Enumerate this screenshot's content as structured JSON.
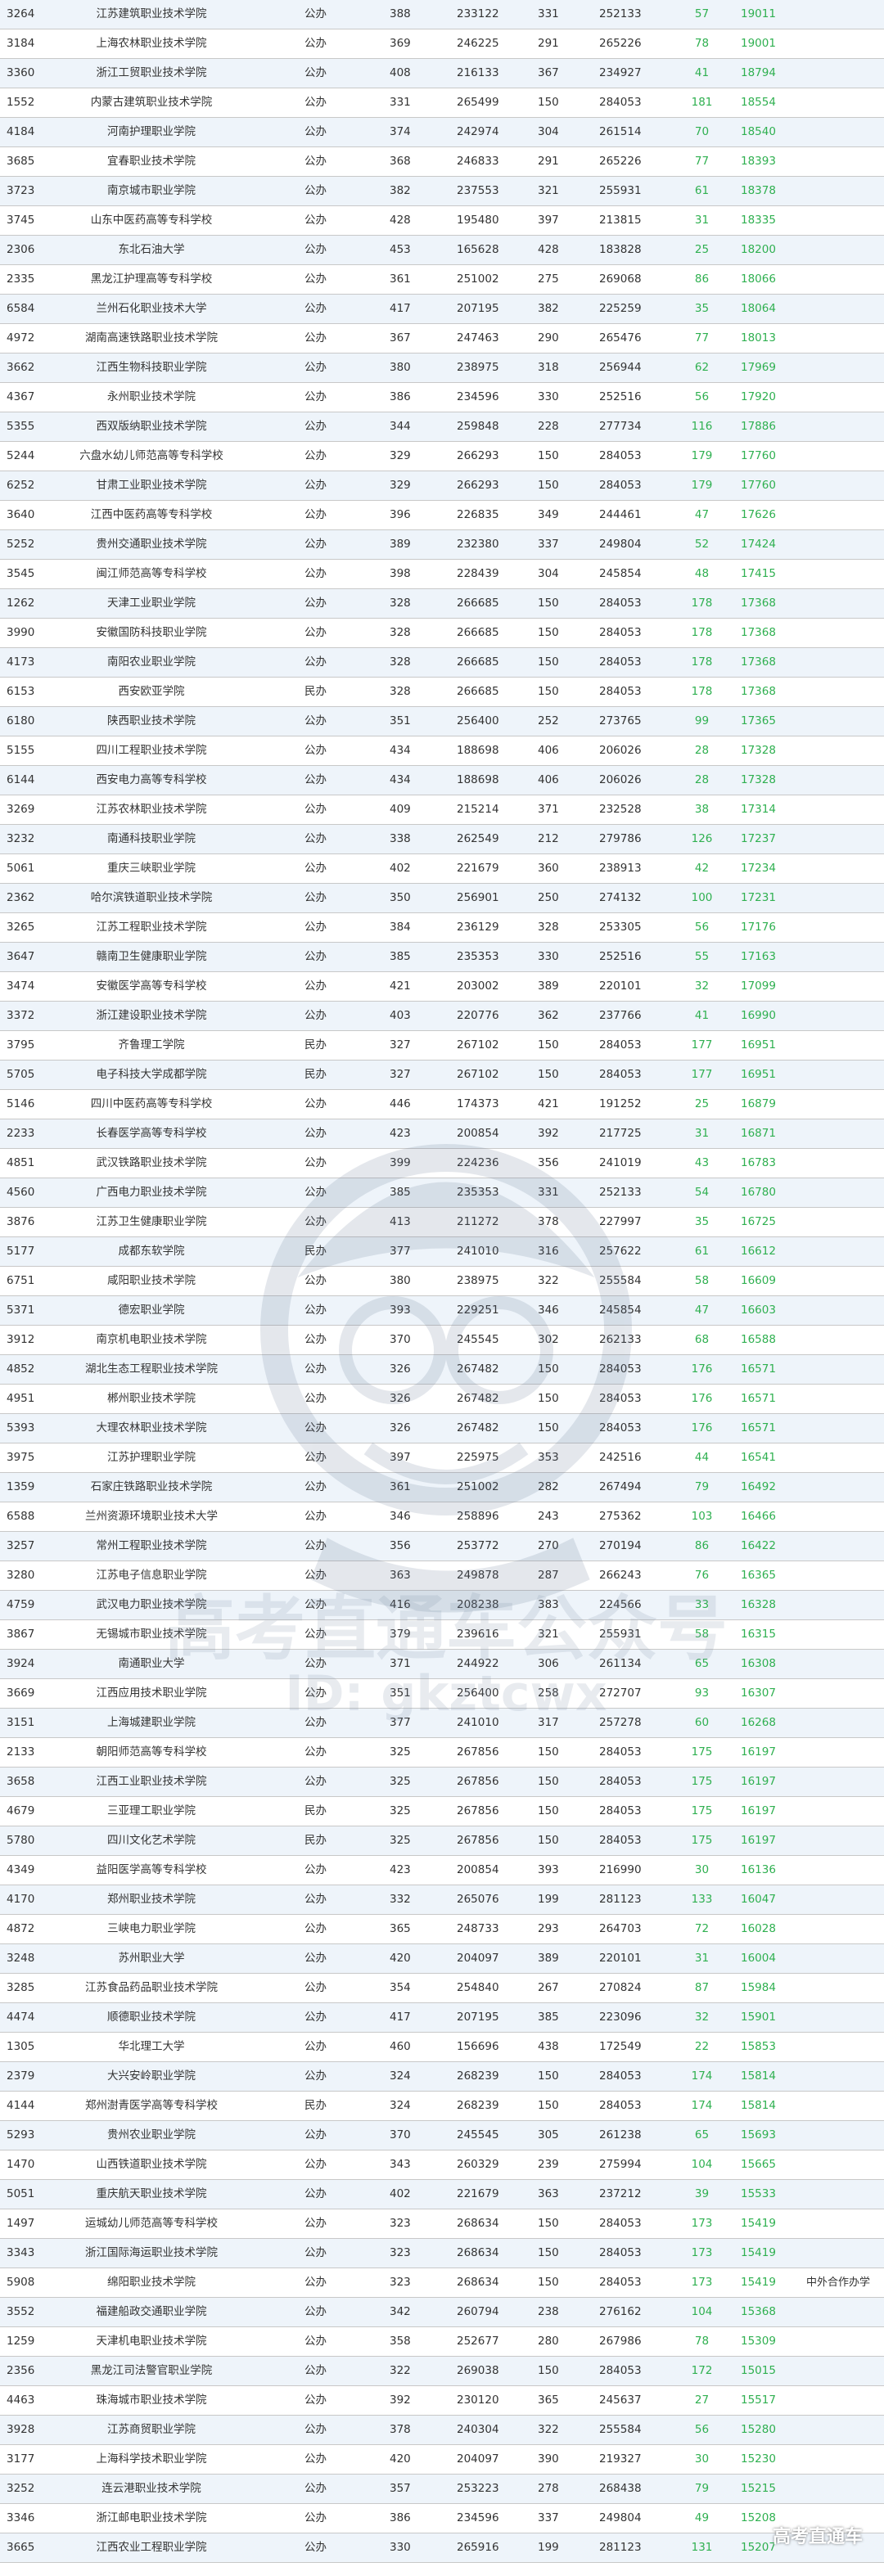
{
  "colors": {
    "accent_green": "#2fb050",
    "row_alt": "#eef4fa",
    "border": "#c8c8c8"
  },
  "watermark": {
    "line1": "高考直通车公众号",
    "line2": "ID: gkztcwx",
    "brand": "高考直通车"
  },
  "rows": [
    [
      "3264",
      "江苏建筑职业技术学院",
      "公办",
      "388",
      "233122",
      "331",
      "252133",
      "57",
      "19011",
      ""
    ],
    [
      "3184",
      "上海农林职业技术学院",
      "公办",
      "369",
      "246225",
      "291",
      "265226",
      "78",
      "19001",
      ""
    ],
    [
      "3360",
      "浙江工贸职业技术学院",
      "公办",
      "408",
      "216133",
      "367",
      "234927",
      "41",
      "18794",
      ""
    ],
    [
      "1552",
      "内蒙古建筑职业技术学院",
      "公办",
      "331",
      "265499",
      "150",
      "284053",
      "181",
      "18554",
      ""
    ],
    [
      "4184",
      "河南护理职业学院",
      "公办",
      "374",
      "242974",
      "304",
      "261514",
      "70",
      "18540",
      ""
    ],
    [
      "3685",
      "宜春职业技术学院",
      "公办",
      "368",
      "246833",
      "291",
      "265226",
      "77",
      "18393",
      ""
    ],
    [
      "3723",
      "南京城市职业学院",
      "公办",
      "382",
      "237553",
      "321",
      "255931",
      "61",
      "18378",
      ""
    ],
    [
      "3745",
      "山东中医药高等专科学校",
      "公办",
      "428",
      "195480",
      "397",
      "213815",
      "31",
      "18335",
      ""
    ],
    [
      "2306",
      "东北石油大学",
      "公办",
      "453",
      "165628",
      "428",
      "183828",
      "25",
      "18200",
      ""
    ],
    [
      "2335",
      "黑龙江护理高等专科学校",
      "公办",
      "361",
      "251002",
      "275",
      "269068",
      "86",
      "18066",
      ""
    ],
    [
      "6584",
      "兰州石化职业技术大学",
      "公办",
      "417",
      "207195",
      "382",
      "225259",
      "35",
      "18064",
      ""
    ],
    [
      "4972",
      "湖南高速铁路职业技术学院",
      "公办",
      "367",
      "247463",
      "290",
      "265476",
      "77",
      "18013",
      ""
    ],
    [
      "3662",
      "江西生物科技职业学院",
      "公办",
      "380",
      "238975",
      "318",
      "256944",
      "62",
      "17969",
      ""
    ],
    [
      "4367",
      "永州职业技术学院",
      "公办",
      "386",
      "234596",
      "330",
      "252516",
      "56",
      "17920",
      ""
    ],
    [
      "5355",
      "西双版纳职业技术学院",
      "公办",
      "344",
      "259848",
      "228",
      "277734",
      "116",
      "17886",
      ""
    ],
    [
      "5244",
      "六盘水幼儿师范高等专科学校",
      "公办",
      "329",
      "266293",
      "150",
      "284053",
      "179",
      "17760",
      ""
    ],
    [
      "6252",
      "甘肃工业职业技术学院",
      "公办",
      "329",
      "266293",
      "150",
      "284053",
      "179",
      "17760",
      ""
    ],
    [
      "3640",
      "江西中医药高等专科学校",
      "公办",
      "396",
      "226835",
      "349",
      "244461",
      "47",
      "17626",
      ""
    ],
    [
      "5252",
      "贵州交通职业技术学院",
      "公办",
      "389",
      "232380",
      "337",
      "249804",
      "52",
      "17424",
      ""
    ],
    [
      "3545",
      "闽江师范高等专科学校",
      "公办",
      "398",
      "228439",
      "304",
      "245854",
      "48",
      "17415",
      ""
    ],
    [
      "1262",
      "天津工业职业学院",
      "公办",
      "328",
      "266685",
      "150",
      "284053",
      "178",
      "17368",
      ""
    ],
    [
      "3990",
      "安徽国防科技职业学院",
      "公办",
      "328",
      "266685",
      "150",
      "284053",
      "178",
      "17368",
      ""
    ],
    [
      "4173",
      "南阳农业职业学院",
      "公办",
      "328",
      "266685",
      "150",
      "284053",
      "178",
      "17368",
      ""
    ],
    [
      "6153",
      "西安欧亚学院",
      "民办",
      "328",
      "266685",
      "150",
      "284053",
      "178",
      "17368",
      ""
    ],
    [
      "6180",
      "陕西职业技术学院",
      "公办",
      "351",
      "256400",
      "252",
      "273765",
      "99",
      "17365",
      ""
    ],
    [
      "5155",
      "四川工程职业技术学院",
      "公办",
      "434",
      "188698",
      "406",
      "206026",
      "28",
      "17328",
      ""
    ],
    [
      "6144",
      "西安电力高等专科学校",
      "公办",
      "434",
      "188698",
      "406",
      "206026",
      "28",
      "17328",
      ""
    ],
    [
      "3269",
      "江苏农林职业技术学院",
      "公办",
      "409",
      "215214",
      "371",
      "232528",
      "38",
      "17314",
      ""
    ],
    [
      "3232",
      "南通科技职业学院",
      "公办",
      "338",
      "262549",
      "212",
      "279786",
      "126",
      "17237",
      ""
    ],
    [
      "5061",
      "重庆三峡职业学院",
      "公办",
      "402",
      "221679",
      "360",
      "238913",
      "42",
      "17234",
      ""
    ],
    [
      "2362",
      "哈尔滨铁道职业技术学院",
      "公办",
      "350",
      "256901",
      "250",
      "274132",
      "100",
      "17231",
      ""
    ],
    [
      "3265",
      "江苏工程职业技术学院",
      "公办",
      "384",
      "236129",
      "328",
      "253305",
      "56",
      "17176",
      ""
    ],
    [
      "3647",
      "赣南卫生健康职业学院",
      "公办",
      "385",
      "235353",
      "330",
      "252516",
      "55",
      "17163",
      ""
    ],
    [
      "3474",
      "安徽医学高等专科学校",
      "公办",
      "421",
      "203002",
      "389",
      "220101",
      "32",
      "17099",
      ""
    ],
    [
      "3372",
      "浙江建设职业技术学院",
      "公办",
      "403",
      "220776",
      "362",
      "237766",
      "41",
      "16990",
      ""
    ],
    [
      "3795",
      "齐鲁理工学院",
      "民办",
      "327",
      "267102",
      "150",
      "284053",
      "177",
      "16951",
      ""
    ],
    [
      "5705",
      "电子科技大学成都学院",
      "民办",
      "327",
      "267102",
      "150",
      "284053",
      "177",
      "16951",
      ""
    ],
    [
      "5146",
      "四川中医药高等专科学校",
      "公办",
      "446",
      "174373",
      "421",
      "191252",
      "25",
      "16879",
      ""
    ],
    [
      "2233",
      "长春医学高等专科学校",
      "公办",
      "423",
      "200854",
      "392",
      "217725",
      "31",
      "16871",
      ""
    ],
    [
      "4851",
      "武汉铁路职业技术学院",
      "公办",
      "399",
      "224236",
      "356",
      "241019",
      "43",
      "16783",
      ""
    ],
    [
      "4560",
      "广西电力职业技术学院",
      "公办",
      "385",
      "235353",
      "331",
      "252133",
      "54",
      "16780",
      ""
    ],
    [
      "3876",
      "江苏卫生健康职业学院",
      "公办",
      "413",
      "211272",
      "378",
      "227997",
      "35",
      "16725",
      ""
    ],
    [
      "5177",
      "成都东软学院",
      "民办",
      "377",
      "241010",
      "316",
      "257622",
      "61",
      "16612",
      ""
    ],
    [
      "6751",
      "咸阳职业技术学院",
      "公办",
      "380",
      "238975",
      "322",
      "255584",
      "58",
      "16609",
      ""
    ],
    [
      "5371",
      "德宏职业学院",
      "公办",
      "393",
      "229251",
      "346",
      "245854",
      "47",
      "16603",
      ""
    ],
    [
      "3912",
      "南京机电职业技术学院",
      "公办",
      "370",
      "245545",
      "302",
      "262133",
      "68",
      "16588",
      ""
    ],
    [
      "4852",
      "湖北生态工程职业技术学院",
      "公办",
      "326",
      "267482",
      "150",
      "284053",
      "176",
      "16571",
      ""
    ],
    [
      "4951",
      "郴州职业技术学院",
      "公办",
      "326",
      "267482",
      "150",
      "284053",
      "176",
      "16571",
      ""
    ],
    [
      "5393",
      "大理农林职业技术学院",
      "公办",
      "326",
      "267482",
      "150",
      "284053",
      "176",
      "16571",
      ""
    ],
    [
      "3975",
      "江苏护理职业学院",
      "公办",
      "397",
      "225975",
      "353",
      "242516",
      "44",
      "16541",
      ""
    ],
    [
      "1359",
      "石家庄铁路职业技术学院",
      "公办",
      "361",
      "251002",
      "282",
      "267494",
      "79",
      "16492",
      ""
    ],
    [
      "6588",
      "兰州资源环境职业技术大学",
      "公办",
      "346",
      "258896",
      "243",
      "275362",
      "103",
      "16466",
      ""
    ],
    [
      "3257",
      "常州工程职业技术学院",
      "公办",
      "356",
      "253772",
      "270",
      "270194",
      "86",
      "16422",
      ""
    ],
    [
      "3280",
      "江苏电子信息职业学院",
      "公办",
      "363",
      "249878",
      "287",
      "266243",
      "76",
      "16365",
      ""
    ],
    [
      "4759",
      "武汉电力职业技术学院",
      "公办",
      "416",
      "208238",
      "383",
      "224566",
      "33",
      "16328",
      ""
    ],
    [
      "3867",
      "无锡城市职业技术学院",
      "公办",
      "379",
      "239616",
      "321",
      "255931",
      "58",
      "16315",
      ""
    ],
    [
      "3924",
      "南通职业大学",
      "公办",
      "371",
      "244922",
      "306",
      "261134",
      "65",
      "16308",
      ""
    ],
    [
      "3669",
      "江西应用技术职业学院",
      "公办",
      "351",
      "256400",
      "258",
      "272707",
      "93",
      "16307",
      ""
    ],
    [
      "3151",
      "上海城建职业学院",
      "公办",
      "377",
      "241010",
      "317",
      "257278",
      "60",
      "16268",
      ""
    ],
    [
      "2133",
      "朝阳师范高等专科学校",
      "公办",
      "325",
      "267856",
      "150",
      "284053",
      "175",
      "16197",
      ""
    ],
    [
      "3658",
      "江西工业职业技术学院",
      "公办",
      "325",
      "267856",
      "150",
      "284053",
      "175",
      "16197",
      ""
    ],
    [
      "4679",
      "三亚理工职业学院",
      "民办",
      "325",
      "267856",
      "150",
      "284053",
      "175",
      "16197",
      ""
    ],
    [
      "5780",
      "四川文化艺术学院",
      "民办",
      "325",
      "267856",
      "150",
      "284053",
      "175",
      "16197",
      ""
    ],
    [
      "4349",
      "益阳医学高等专科学校",
      "公办",
      "423",
      "200854",
      "393",
      "216990",
      "30",
      "16136",
      ""
    ],
    [
      "4170",
      "郑州职业技术学院",
      "公办",
      "332",
      "265076",
      "199",
      "281123",
      "133",
      "16047",
      ""
    ],
    [
      "4872",
      "三峡电力职业学院",
      "公办",
      "365",
      "248733",
      "293",
      "264703",
      "72",
      "16028",
      ""
    ],
    [
      "3248",
      "苏州职业大学",
      "公办",
      "420",
      "204097",
      "389",
      "220101",
      "31",
      "16004",
      ""
    ],
    [
      "3285",
      "江苏食品药品职业技术学院",
      "公办",
      "354",
      "254840",
      "267",
      "270824",
      "87",
      "15984",
      ""
    ],
    [
      "4474",
      "顺德职业技术学院",
      "公办",
      "417",
      "207195",
      "385",
      "223096",
      "32",
      "15901",
      ""
    ],
    [
      "1305",
      "华北理工大学",
      "公办",
      "460",
      "156696",
      "438",
      "172549",
      "22",
      "15853",
      ""
    ],
    [
      "2379",
      "大兴安岭职业学院",
      "公办",
      "324",
      "268239",
      "150",
      "284053",
      "174",
      "15814",
      ""
    ],
    [
      "4144",
      "郑州澍青医学高等专科学校",
      "民办",
      "324",
      "268239",
      "150",
      "284053",
      "174",
      "15814",
      ""
    ],
    [
      "5293",
      "贵州农业职业学院",
      "公办",
      "370",
      "245545",
      "305",
      "261238",
      "65",
      "15693",
      ""
    ],
    [
      "1470",
      "山西铁道职业技术学院",
      "公办",
      "343",
      "260329",
      "239",
      "275994",
      "104",
      "15665",
      ""
    ],
    [
      "5051",
      "重庆航天职业技术学院",
      "公办",
      "402",
      "221679",
      "363",
      "237212",
      "39",
      "15533",
      ""
    ],
    [
      "1497",
      "运城幼儿师范高等专科学校",
      "公办",
      "323",
      "268634",
      "150",
      "284053",
      "173",
      "15419",
      ""
    ],
    [
      "3343",
      "浙江国际海运职业技术学院",
      "公办",
      "323",
      "268634",
      "150",
      "284053",
      "173",
      "15419",
      ""
    ],
    [
      "5908",
      "绵阳职业技术学院",
      "公办",
      "323",
      "268634",
      "150",
      "284053",
      "173",
      "15419",
      "中外合作办学"
    ],
    [
      "3552",
      "福建船政交通职业学院",
      "公办",
      "342",
      "260794",
      "238",
      "276162",
      "104",
      "15368",
      ""
    ],
    [
      "1259",
      "天津机电职业技术学院",
      "公办",
      "358",
      "252677",
      "280",
      "267986",
      "78",
      "15309",
      ""
    ],
    [
      "2356",
      "黑龙江司法警官职业学院",
      "公办",
      "322",
      "269038",
      "150",
      "284053",
      "172",
      "15015",
      ""
    ],
    [
      "4463",
      "珠海城市职业技术学院",
      "公办",
      "392",
      "230120",
      "365",
      "245637",
      "27",
      "15517",
      ""
    ],
    [
      "3928",
      "江苏商贸职业学院",
      "公办",
      "378",
      "240304",
      "322",
      "255584",
      "56",
      "15280",
      ""
    ],
    [
      "3177",
      "上海科学技术职业学院",
      "公办",
      "420",
      "204097",
      "390",
      "219327",
      "30",
      "15230",
      ""
    ],
    [
      "3252",
      "连云港职业技术学院",
      "公办",
      "357",
      "253223",
      "278",
      "268438",
      "79",
      "15215",
      ""
    ],
    [
      "3346",
      "浙江邮电职业技术学院",
      "公办",
      "386",
      "234596",
      "337",
      "249804",
      "49",
      "15208",
      ""
    ],
    [
      "3665",
      "江西农业工程职业学院",
      "公办",
      "330",
      "265916",
      "199",
      "281123",
      "131",
      "15207",
      ""
    ]
  ]
}
